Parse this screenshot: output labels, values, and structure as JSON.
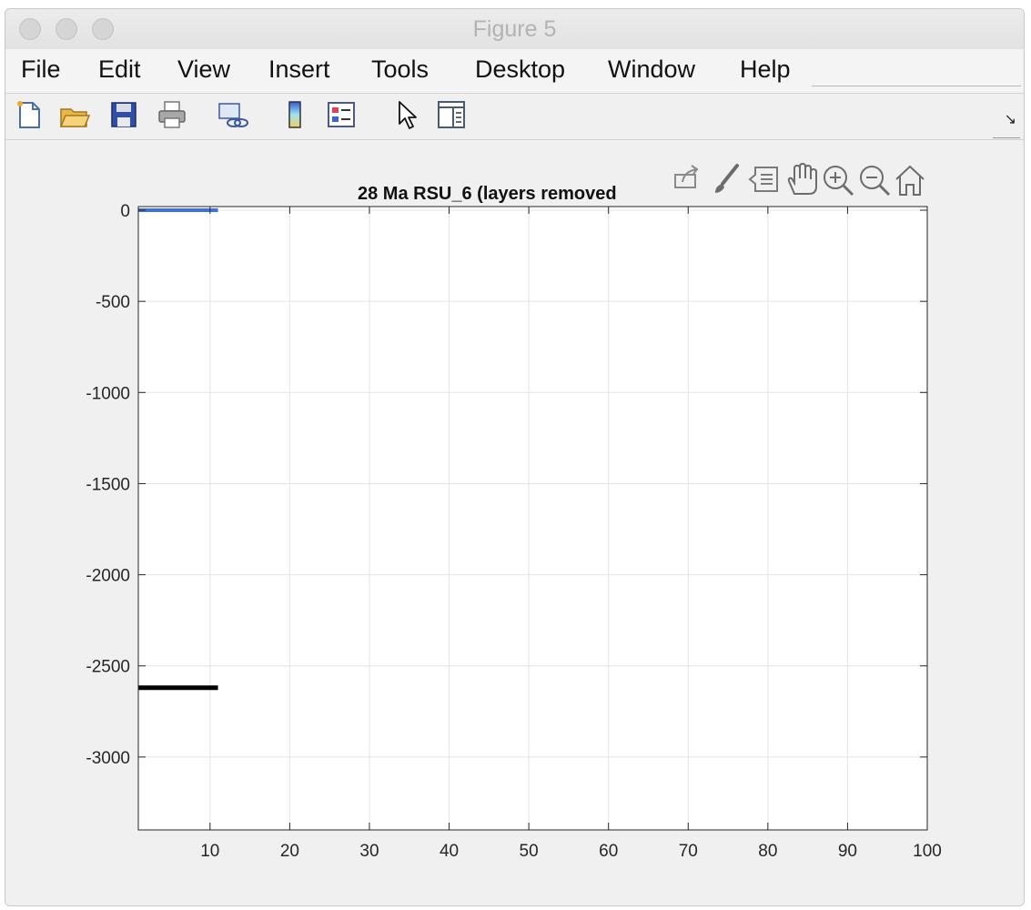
{
  "window": {
    "title": "Figure 5"
  },
  "menu": {
    "items": [
      "File",
      "Edit",
      "View",
      "Insert",
      "Tools",
      "Desktop",
      "Window",
      "Help"
    ]
  },
  "toolbar": {
    "icons": [
      "new-figure-icon",
      "open-file-icon",
      "save-icon",
      "print-icon",
      "link-figure-icon",
      "colorbar-icon",
      "legend-icon",
      "edit-plot-arrow-icon",
      "property-inspector-icon"
    ],
    "collapse_glyph": "↘"
  },
  "axes_toolbar": {
    "icons": [
      "export-icon",
      "brush-icon",
      "datatip-icon",
      "pan-icon",
      "zoom-in-icon",
      "zoom-out-icon",
      "home-icon"
    ]
  },
  "colors": {
    "series_surface": "#3d6fe8",
    "series_basement": "#000000",
    "grid": "#e4e4e4"
  },
  "chart_data": {
    "type": "line",
    "title": "28 Ma   RSU_6      (layers removed",
    "xlabel": "",
    "ylabel": "",
    "xlim": [
      1,
      100
    ],
    "ylim": [
      -3400,
      20
    ],
    "xticks": [
      10,
      20,
      30,
      40,
      50,
      60,
      70,
      80,
      90,
      100
    ],
    "yticks": [
      0,
      -500,
      -1000,
      -1500,
      -2000,
      -2500,
      -3000
    ],
    "grid": true,
    "series": [
      {
        "color": "#3d6fe8",
        "x": [
          1,
          11
        ],
        "y": [
          0,
          0
        ]
      },
      {
        "color": "#000000",
        "x": [
          1,
          11
        ],
        "y": [
          -2620,
          -2620
        ]
      }
    ]
  }
}
